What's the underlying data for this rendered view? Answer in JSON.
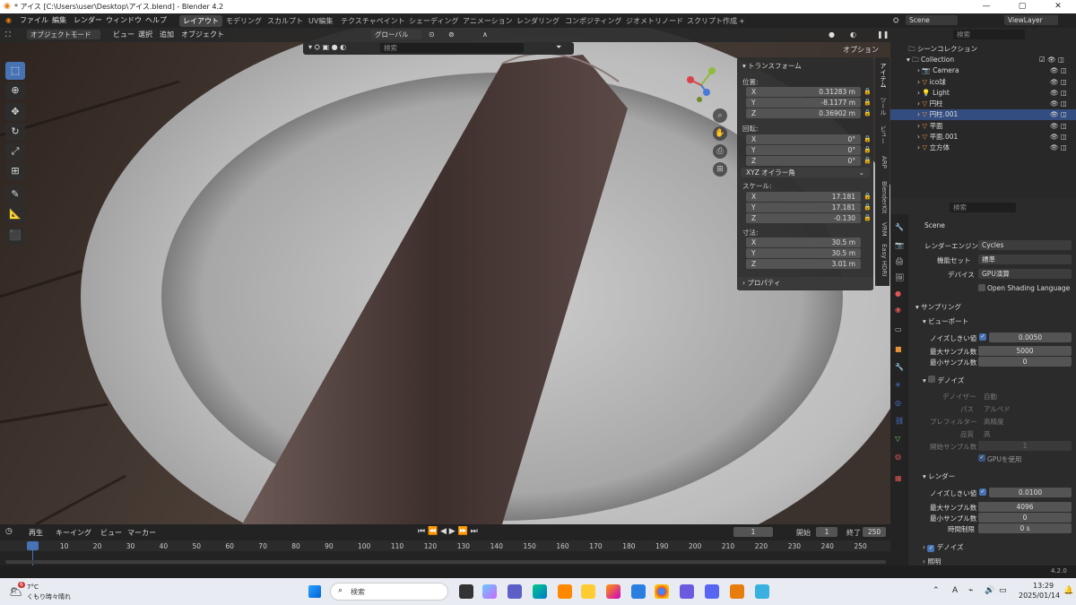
{
  "window": {
    "title": "* アイス [C:\\Users\\user\\Desktop\\アイス.blend] - Blender 4.2"
  },
  "menu": {
    "items": [
      "ファイル",
      "編集",
      "レンダー",
      "ウィンドウ",
      "ヘルプ"
    ]
  },
  "workspaces": [
    "レイアウト",
    "モデリング",
    "スカルプト",
    "UV編集",
    "テクスチャペイント",
    "シェーディング",
    "アニメーション",
    "レンダリング",
    "コンポジティング",
    "ジオメトリノード",
    "スクリプト作成",
    "+"
  ],
  "scene": {
    "name": "Scene",
    "view_layer": "ViewLayer"
  },
  "viewport_header": {
    "mode": "オブジェクトモード",
    "menus": [
      "ビュー",
      "選択",
      "追加",
      "オブジェクト"
    ],
    "orientation": "グローバル",
    "search_placeholder": "検索",
    "options": "オプション"
  },
  "transform": {
    "title": "トランスフォーム",
    "location_label": "位置:",
    "location": {
      "x": "0.31283 m",
      "y": "-8.1177 m",
      "z": "0.36902 m"
    },
    "rotation_label": "回転:",
    "rotation": {
      "x": "0°",
      "y": "0°",
      "z": "0°"
    },
    "rotation_mode": "XYZ オイラー角",
    "scale_label": "スケール:",
    "scale": {
      "x": "17.181",
      "y": "17.181",
      "z": "-0.130"
    },
    "dimensions_label": "寸法:",
    "dimensions": {
      "x": "30.5 m",
      "y": "30.5 m",
      "z": "3.01 m"
    },
    "axis": {
      "x": "X",
      "y": "Y",
      "z": "Z"
    },
    "properties": "プロパティ"
  },
  "side_tabs": [
    "アイテム",
    "ツール",
    "ビュー",
    "ARP",
    "BlenderKit",
    "VRM",
    "Easy HDRI"
  ],
  "outliner": {
    "search_placeholder": "検索",
    "root": "シーンコレクション",
    "collection": "Collection",
    "items": [
      "Camera",
      "ico球",
      "Light",
      "円柱",
      "円柱.001",
      "平面",
      "平面.001",
      "立方体"
    ]
  },
  "properties_panel": {
    "search_placeholder": "検索",
    "scene": "Scene",
    "render_engine_label": "レンダーエンジン",
    "render_engine": "Cycles",
    "feature_set_label": "機能セット",
    "feature_set": "標準",
    "device_label": "デバイス",
    "device": "GPU演算",
    "osl": "Open Shading Language",
    "sampling": "サンプリング",
    "viewport": "ビューポート",
    "noise_threshold_label": "ノイズしきい値",
    "viewport_noise": "0.0050",
    "max_samples_label": "最大サンプル数",
    "viewport_max": "5000",
    "min_samples_label": "最小サンプル数",
    "viewport_min": "0",
    "denoise": "デノイズ",
    "denoiser_label": "デノイザー",
    "denoiser": "自動",
    "passes_label": "パス",
    "passes": "アルベド",
    "prefilter_label": "プレフィルター",
    "prefilter": "高精度",
    "quality_label": "品質",
    "quality": "高",
    "start_sample_label": "開始サンプル数",
    "start_sample": "1",
    "use_gpu": "GPUを使用",
    "render": "レンダー",
    "render_noise": "0.0100",
    "render_max": "4096",
    "render_min": "0",
    "time_limit_label": "時間制限",
    "time_limit": "0 s",
    "render_denoise": "デノイズ",
    "lighting": "照明"
  },
  "timeline": {
    "menus": [
      "再生",
      "キーイング",
      "ビュー",
      "マーカー"
    ],
    "current_frame": "1",
    "start_label": "開始",
    "start": "1",
    "end_label": "終了",
    "end": "250",
    "ticks": [
      "1",
      "10",
      "20",
      "30",
      "40",
      "50",
      "60",
      "70",
      "80",
      "90",
      "100",
      "110",
      "120",
      "130",
      "140",
      "150",
      "160",
      "170",
      "180",
      "190",
      "200",
      "210",
      "220",
      "230",
      "240",
      "250"
    ]
  },
  "status": {
    "version": "4.2.0"
  },
  "taskbar": {
    "weather_temp": "7°C",
    "weather_text": "くもり時々晴れ",
    "weather_badge": "6",
    "search_placeholder": "検索",
    "time": "13:29",
    "date": "2025/01/14",
    "ime": "A"
  },
  "colors": {
    "accent": "#4772b3",
    "active_row": "#334d80",
    "object_orange": "#e6913a",
    "mesh_green": "#6fcf6f"
  }
}
